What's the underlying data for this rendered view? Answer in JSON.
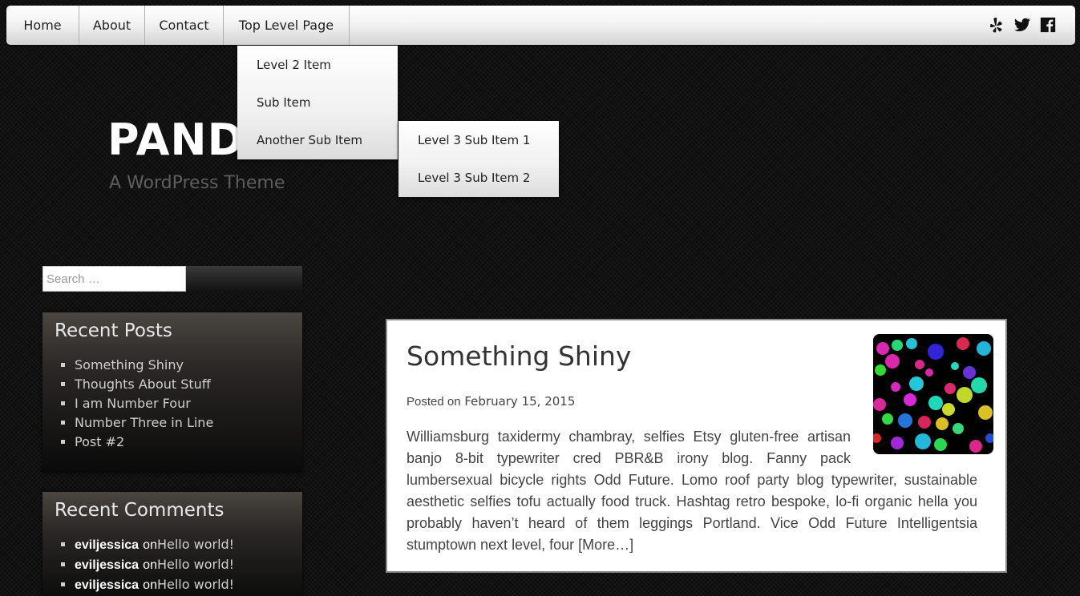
{
  "nav": {
    "items": [
      "Home",
      "About",
      "Contact",
      "Top Level Page"
    ],
    "dropdown_level2": [
      "Level 2 Item",
      "Sub Item",
      "Another Sub Item"
    ],
    "dropdown_level3": [
      "Level 3 Sub Item 1",
      "Level 3 Sub Item 2"
    ],
    "social_icons": [
      "yelp-icon",
      "twitter-icon",
      "facebook-icon"
    ]
  },
  "site": {
    "title": "PANDA",
    "tagline": "A WordPress Theme"
  },
  "sidebar": {
    "search_placeholder": "Search …",
    "recent_posts": {
      "title": "Recent Posts",
      "items": [
        "Something Shiny",
        "Thoughts About Stuff",
        "I am Number Four",
        "Number Three in Line",
        "Post #2"
      ]
    },
    "recent_comments": {
      "title": "Recent Comments",
      "items": [
        {
          "author": "eviljessica",
          "on": "on",
          "post": "Hello world!"
        },
        {
          "author": "eviljessica",
          "on": "on",
          "post": "Hello world!"
        },
        {
          "author": "eviljessica",
          "on": "on",
          "post": "Hello world!"
        }
      ]
    }
  },
  "post": {
    "title": "Something Shiny",
    "posted_on_label": "Posted on",
    "date": "February 15, 2015",
    "excerpt": "Williamsburg taxidermy chambray, selfies Etsy gluten-free artisan banjo 8-bit typewriter cred PBR&B irony blog. Fanny pack lumbersexual bicycle rights Odd Future. Lomo roof party blog typewriter, sustainable aesthetic selfies tofu actually food truck. Hashtag retro bespoke, lo-fi organic hella you probably haven’t heard of them leggings Portland. Vice Odd Future Intelligentsia stumptown next level, four",
    "more_label": "[More…]"
  },
  "colors": {
    "background": "#0d0d0d",
    "nav_text": "#222222",
    "site_title": "#ffffff",
    "tagline": "#5e5e5e",
    "widget_text": "#cfcfcf",
    "post_text": "#444444"
  }
}
